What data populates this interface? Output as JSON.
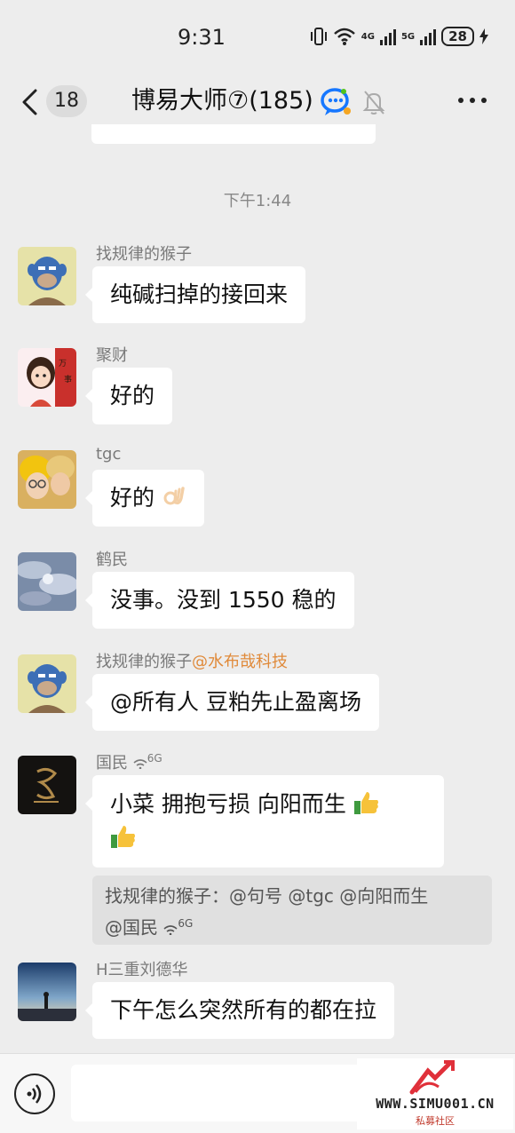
{
  "status_bar": {
    "time": "9:31",
    "battery": "28",
    "net_a": "4G",
    "net_b": "5G",
    "wifi_tag": "6"
  },
  "header": {
    "back_icon": "chevron-left-icon",
    "unread_count": "18",
    "title": "博易大师⑦(185)",
    "group_icon": "qq-group-icon",
    "mute_icon": "bell-off-icon",
    "more_icon": "more-dots-icon"
  },
  "timestamp": "下午1:44",
  "messages": [
    {
      "sender": "找规律的猴子",
      "text": "纯碱扫掉的接回来",
      "avatar": "ape-avatar"
    },
    {
      "sender": "聚财",
      "text": "好的",
      "avatar": "girl-avatar"
    },
    {
      "sender": "tgc",
      "text": "好的",
      "emoji": "ok-hand",
      "avatar": "couple-avatar"
    },
    {
      "sender": "鹤民",
      "text": "没事。没到 1550 稳的",
      "avatar": "sky-avatar"
    },
    {
      "sender": "找规律的猴子",
      "mention": "@水布哉科技",
      "text": "@所有人 豆粕先止盈离场",
      "avatar": "ape-avatar"
    },
    {
      "sender": "国民",
      "sender_tag": "6G",
      "text": "小菜  拥抱亏损  向阳而生",
      "emoji": "thumbs-up",
      "avatar": "dark-avatar"
    },
    {
      "sender": "H三重刘德华",
      "text": "下午怎么突然所有的都在拉",
      "avatar": "sunset-avatar"
    }
  ],
  "quote": {
    "line1": "找规律的猴子：@句号 @tgc @向阳而生",
    "line2": "@国民",
    "tag": "6G"
  },
  "input": {
    "voice_icon": "voice-icon",
    "placeholder": ""
  },
  "watermark": {
    "domain": "WWW.SIMU001.CN",
    "sub": "私募社区"
  },
  "colors": {
    "background": "#ededed",
    "bubble": "#ffffff",
    "mention": "#e08a3a",
    "watermark_red": "#c0392b"
  }
}
